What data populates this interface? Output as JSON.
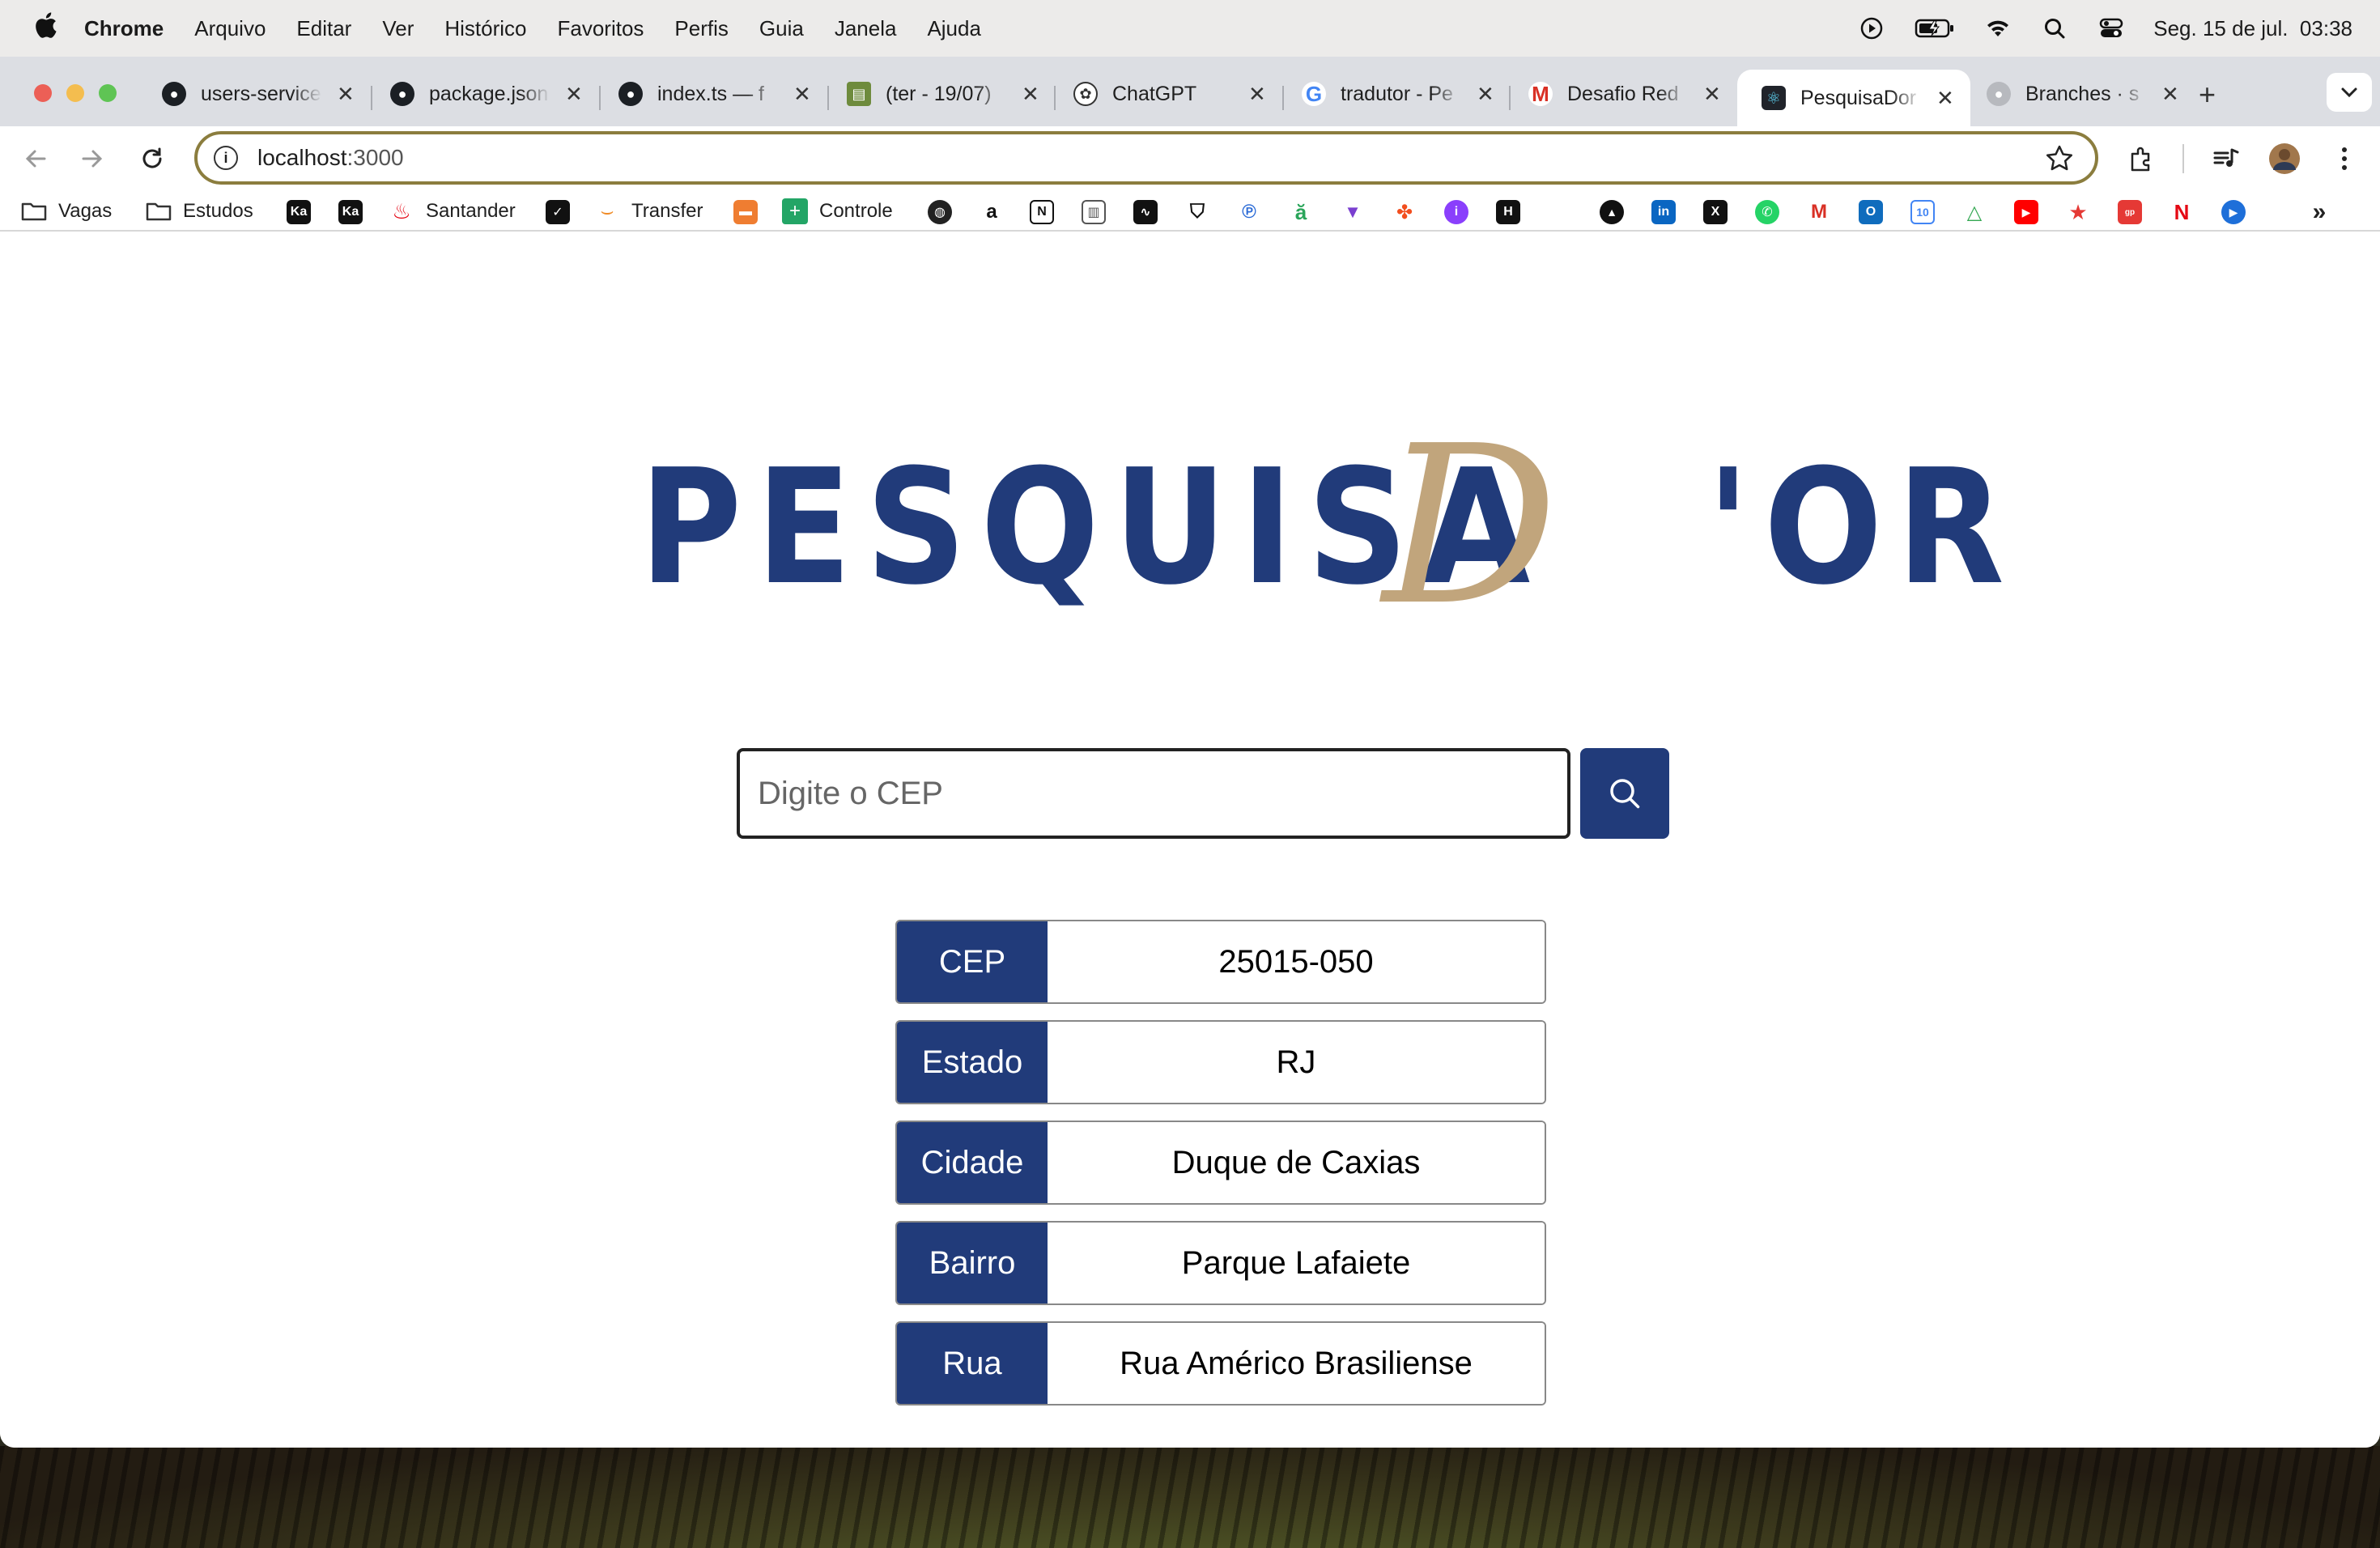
{
  "menubar": {
    "app_name": "Chrome",
    "items": [
      "Arquivo",
      "Editar",
      "Ver",
      "Histórico",
      "Favoritos",
      "Perfis",
      "Guia",
      "Janela",
      "Ajuda"
    ],
    "datetime": "Seg. 15 de jul.  03:38"
  },
  "tabs": [
    {
      "label": "users-service",
      "icon": "github-icon"
    },
    {
      "label": "package.json",
      "icon": "github-icon"
    },
    {
      "label": "index.ts — f",
      "icon": "github-icon"
    },
    {
      "label": "(ter - 19/07)",
      "icon": "books-icon"
    },
    {
      "label": "ChatGPT",
      "icon": "chatgpt-icon"
    },
    {
      "label": "tradutor - Pe",
      "icon": "google-icon"
    },
    {
      "label": "Desafio Red",
      "icon": "gmail-icon"
    },
    {
      "label": "PesquisaDor",
      "icon": "react-icon",
      "active": true
    },
    {
      "label": "Branches · s",
      "icon": "github-icon"
    }
  ],
  "toolbar": {
    "url_host": "localhost",
    "url_port": ":3000"
  },
  "bookmarks": {
    "folders": [
      "Vagas",
      "Estudos"
    ],
    "links": [
      "Santander",
      "Transfer",
      "Controle"
    ]
  },
  "search": {
    "placeholder": "Digite o CEP"
  },
  "logo": {
    "main": "PESQUISA",
    "accent": "D",
    "tail": "'OR"
  },
  "results": [
    {
      "label": "CEP",
      "value": "25015-050"
    },
    {
      "label": "Estado",
      "value": "RJ"
    },
    {
      "label": "Cidade",
      "value": "Duque de Caxias"
    },
    {
      "label": "Bairro",
      "value": "Parque Lafaiete"
    },
    {
      "label": "Rua",
      "value": "Rua Américo Brasiliense"
    }
  ],
  "colors": {
    "brand_blue": "#213b7a",
    "brand_gold": "#c1a57c"
  }
}
